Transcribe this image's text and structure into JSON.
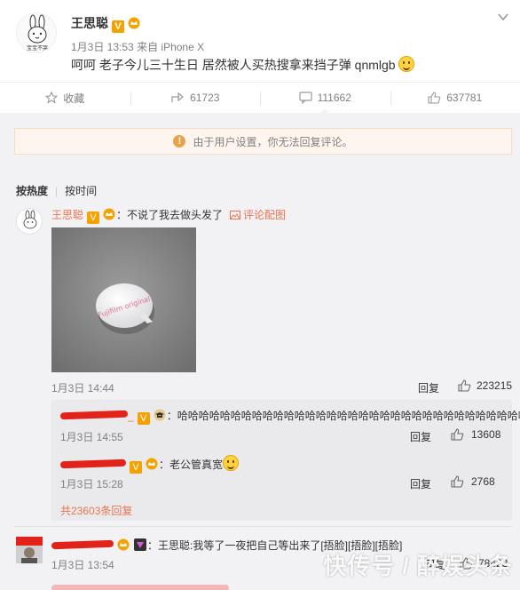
{
  "post": {
    "author": "王思聪",
    "v_badge": "V",
    "time": "1月3日 13:53",
    "source": "来自 iPhone X",
    "text": "呵呵 老子今儿三十生日 居然被人买热搜拿来挡子弹 qnmlgb",
    "avatar_label": "宝宝不哭"
  },
  "actions": {
    "favorite": "收藏",
    "share": "61723",
    "comment": "111662",
    "like": "637781"
  },
  "notice": "由于用户设置，你无法回复评论。",
  "sort": {
    "hot": "按热度",
    "time": "按时间"
  },
  "comment1": {
    "author": "王思聪",
    "text": "：不说了我去做头发了",
    "pic_link": "评论配图",
    "pic_caption": "Fujifilm original",
    "time": "1月3日 14:44",
    "reply": "回复",
    "likes": "223215"
  },
  "subcomments": [
    {
      "text": "：哈哈哈哈哈哈哈哈哈哈哈哈哈哈哈哈哈哈哈哈哈哈哈哈哈哈哈哈哈哈哈哈哈哈",
      "time": "1月3日 14:55",
      "reply": "回复",
      "likes": "13608"
    },
    {
      "text": "：老公管真宽",
      "time": "1月3日 15:28",
      "reply": "回复",
      "likes": "2768"
    }
  ],
  "total_replies": "共23603条回复",
  "comment2": {
    "text": "：王思聪:我等了一夜把自己等出来了[捂脸][捂脸][捂脸]",
    "time": "1月3日 13:54",
    "reply": "回复",
    "likes": "78423"
  },
  "watermark": "快传号 / 醉娱头条",
  "colors": {
    "accent": "#eb7350",
    "redact": "#e2231a",
    "badge": "#f5a100"
  }
}
